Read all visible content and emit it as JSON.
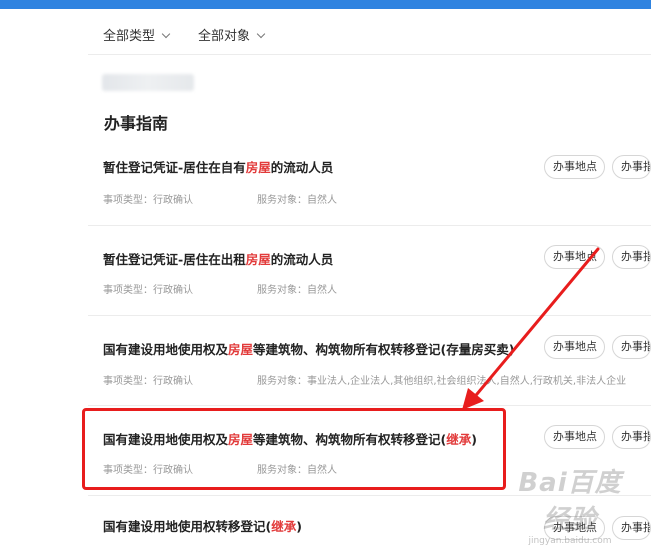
{
  "filters": {
    "type_label": "全部类型",
    "target_label": "全部对象"
  },
  "section_title": "办事指南",
  "meta_labels": {
    "type_prefix": "事项类型：",
    "target_prefix": "服务对象："
  },
  "buttons": {
    "location": "办事地点",
    "guide": "办事指南"
  },
  "items": [
    {
      "title_before": "暂住登记凭证-居住在自有",
      "title_highlight": "房屋",
      "title_after": "的流动人员",
      "title_paren": "",
      "title_close": "",
      "type": "行政确认",
      "target": "自然人"
    },
    {
      "title_before": "暂住登记凭证-居住在出租",
      "title_highlight": "房屋",
      "title_after": "的流动人员",
      "title_paren": "",
      "title_close": "",
      "type": "行政确认",
      "target": "自然人"
    },
    {
      "title_before": "国有建设用地使用权及",
      "title_highlight": "房屋",
      "title_after": "等建筑物、构筑物所有权转移登记(存量房买卖)",
      "title_paren": "",
      "title_close": "",
      "type": "行政确认",
      "target": "事业法人,企业法人,其他组织,社会组织法人,自然人,行政机关,非法人企业"
    },
    {
      "title_before": "国有建设用地使用权及",
      "title_highlight": "房屋",
      "title_after": "等建筑物、构筑物所有权转移登记(",
      "title_paren": "继承",
      "title_close": ")",
      "type": "行政确认",
      "target": "自然人"
    }
  ],
  "bottom_item": {
    "title_before": "国有建设用地使用权转移登记(",
    "title_paren": "继承",
    "title_close": ")"
  },
  "watermark": {
    "logo": "Bai百度经验",
    "url": "jingyan.baidu.com"
  },
  "colors": {
    "highlight_text": "#e23b3b",
    "annotation_red": "#e81d1d",
    "topbar_blue": "#2f83e0"
  }
}
